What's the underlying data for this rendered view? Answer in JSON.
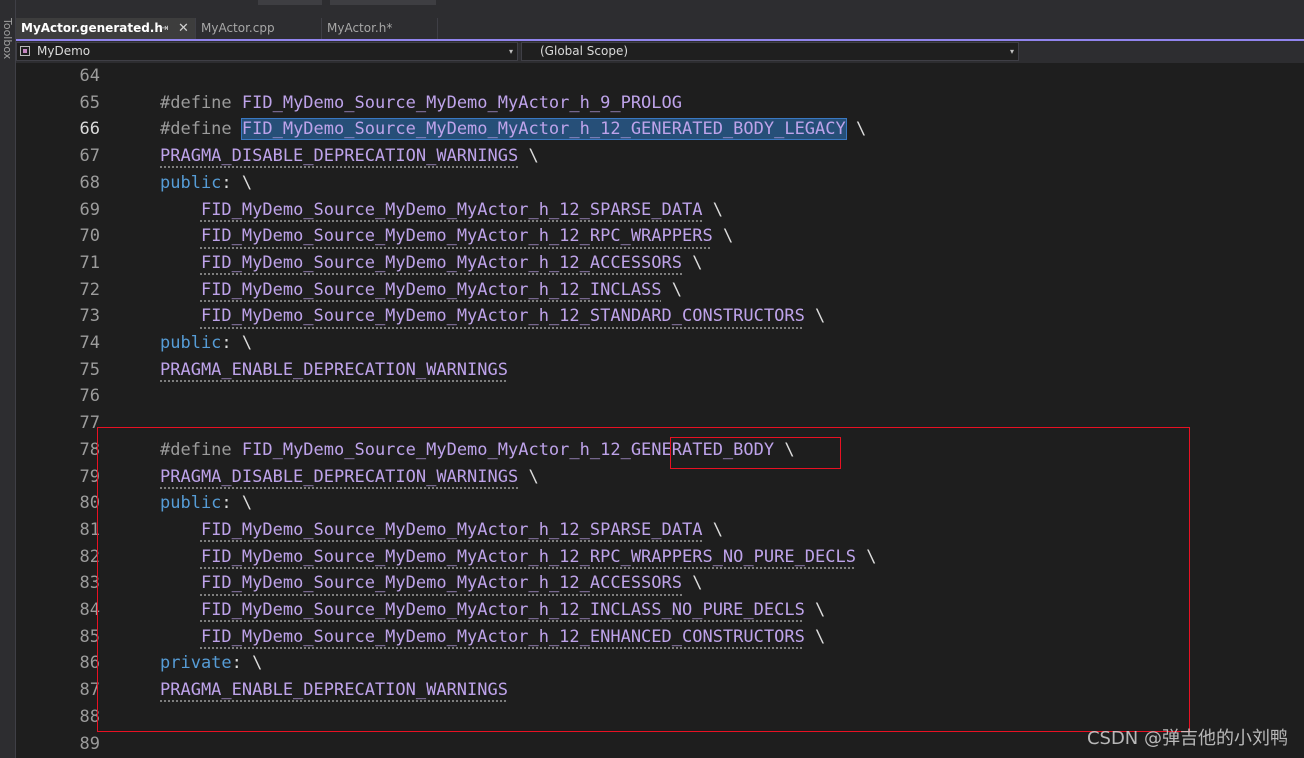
{
  "toolbox": {
    "label": "Toolbox"
  },
  "tabs": [
    {
      "label": "MyActor.generated.h",
      "active": true
    },
    {
      "label": "MyActor.cpp",
      "active": false
    },
    {
      "label": "MyActor.h*",
      "active": false
    }
  ],
  "tab_icons": {
    "pin": "⇥",
    "close": "✕"
  },
  "navbar": {
    "project": "MyDemo",
    "scope": "(Global Scope)",
    "caret": "▾"
  },
  "lines": [
    {
      "number": "64",
      "tokens": []
    },
    {
      "number": "65",
      "tokens": [
        [
          "define",
          "#define "
        ],
        [
          "macro",
          "FID_MyDemo_Source_MyDemo_MyActor_h_9_PROLOG"
        ]
      ]
    },
    {
      "number": "66",
      "current": true,
      "tokens": [
        [
          "define",
          "#define "
        ],
        [
          "sel",
          "FID_MyDemo_Source_MyDemo_MyActor_h_12_GENERATED_BODY_LEGACY"
        ],
        [
          "plain",
          " \\"
        ]
      ]
    },
    {
      "number": "67",
      "tokens": [
        [
          "macro-dots",
          "PRAGMA_DISABLE_DEPRECATION_WARNINGS"
        ],
        [
          "plain",
          " \\"
        ]
      ]
    },
    {
      "number": "68",
      "tokens": [
        [
          "kw",
          "public"
        ],
        [
          "plain",
          ": \\"
        ]
      ]
    },
    {
      "number": "69",
      "tokens": [
        [
          "plain",
          "    "
        ],
        [
          "macro-dots",
          "FID_MyDemo_Source_MyDemo_MyActor_h_12_SPARSE_DATA"
        ],
        [
          "plain",
          " \\"
        ]
      ]
    },
    {
      "number": "70",
      "tokens": [
        [
          "plain",
          "    "
        ],
        [
          "macro-dots",
          "FID_MyDemo_Source_MyDemo_MyActor_h_12_RPC_WRAPPERS"
        ],
        [
          "plain",
          " \\"
        ]
      ]
    },
    {
      "number": "71",
      "tokens": [
        [
          "plain",
          "    "
        ],
        [
          "macro-dots",
          "FID_MyDemo_Source_MyDemo_MyActor_h_12_ACCESSORS"
        ],
        [
          "plain",
          " \\"
        ]
      ]
    },
    {
      "number": "72",
      "tokens": [
        [
          "plain",
          "    "
        ],
        [
          "macro-dots",
          "FID_MyDemo_Source_MyDemo_MyActor_h_12_INCLASS"
        ],
        [
          "plain",
          " \\"
        ]
      ]
    },
    {
      "number": "73",
      "tokens": [
        [
          "plain",
          "    "
        ],
        [
          "macro-dots",
          "FID_MyDemo_Source_MyDemo_MyActor_h_12_STANDARD_CONSTRUCTORS"
        ],
        [
          "plain",
          " \\"
        ]
      ]
    },
    {
      "number": "74",
      "tokens": [
        [
          "kw",
          "public"
        ],
        [
          "plain",
          ": \\"
        ]
      ]
    },
    {
      "number": "75",
      "tokens": [
        [
          "macro-dots",
          "PRAGMA_ENABLE_DEPRECATION_WARNINGS"
        ]
      ]
    },
    {
      "number": "76",
      "tokens": []
    },
    {
      "number": "77",
      "tokens": []
    },
    {
      "number": "78",
      "tokens": [
        [
          "define",
          "#define "
        ],
        [
          "macro",
          "FID_MyDemo_Source_MyDemo_MyActor_h_12_GENERATED_BODY"
        ],
        [
          "plain",
          " \\"
        ]
      ]
    },
    {
      "number": "79",
      "tokens": [
        [
          "macro-dots",
          "PRAGMA_DISABLE_DEPRECATION_WARNINGS"
        ],
        [
          "plain",
          " \\"
        ]
      ]
    },
    {
      "number": "80",
      "tokens": [
        [
          "kw",
          "public"
        ],
        [
          "plain",
          ": \\"
        ]
      ]
    },
    {
      "number": "81",
      "tokens": [
        [
          "plain",
          "    "
        ],
        [
          "macro-dots",
          "FID_MyDemo_Source_MyDemo_MyActor_h_12_SPARSE_DATA"
        ],
        [
          "plain",
          " \\"
        ]
      ]
    },
    {
      "number": "82",
      "tokens": [
        [
          "plain",
          "    "
        ],
        [
          "macro-dots",
          "FID_MyDemo_Source_MyDemo_MyActor_h_12_RPC_WRAPPERS_NO_PURE_DECLS"
        ],
        [
          "plain",
          " \\"
        ]
      ]
    },
    {
      "number": "83",
      "tokens": [
        [
          "plain",
          "    "
        ],
        [
          "macro-dots",
          "FID_MyDemo_Source_MyDemo_MyActor_h_12_ACCESSORS"
        ],
        [
          "plain",
          " \\"
        ]
      ]
    },
    {
      "number": "84",
      "tokens": [
        [
          "plain",
          "    "
        ],
        [
          "macro-dots",
          "FID_MyDemo_Source_MyDemo_MyActor_h_12_INCLASS_NO_PURE_DECLS"
        ],
        [
          "plain",
          " \\"
        ]
      ]
    },
    {
      "number": "85",
      "tokens": [
        [
          "plain",
          "    "
        ],
        [
          "macro-dots",
          "FID_MyDemo_Source_MyDemo_MyActor_h_12_ENHANCED_CONSTRUCTORS"
        ],
        [
          "plain",
          " \\"
        ]
      ]
    },
    {
      "number": "86",
      "tokens": [
        [
          "kw",
          "private"
        ],
        [
          "plain",
          ": \\"
        ]
      ]
    },
    {
      "number": "87",
      "tokens": [
        [
          "macro-dots",
          "PRAGMA_ENABLE_DEPRECATION_WARNINGS"
        ]
      ]
    },
    {
      "number": "88",
      "tokens": []
    },
    {
      "number": "89",
      "tokens": []
    }
  ],
  "annotations": {
    "highlight_color": "#e81123"
  },
  "watermark": "CSDN @弹吉他的小刘鸭"
}
